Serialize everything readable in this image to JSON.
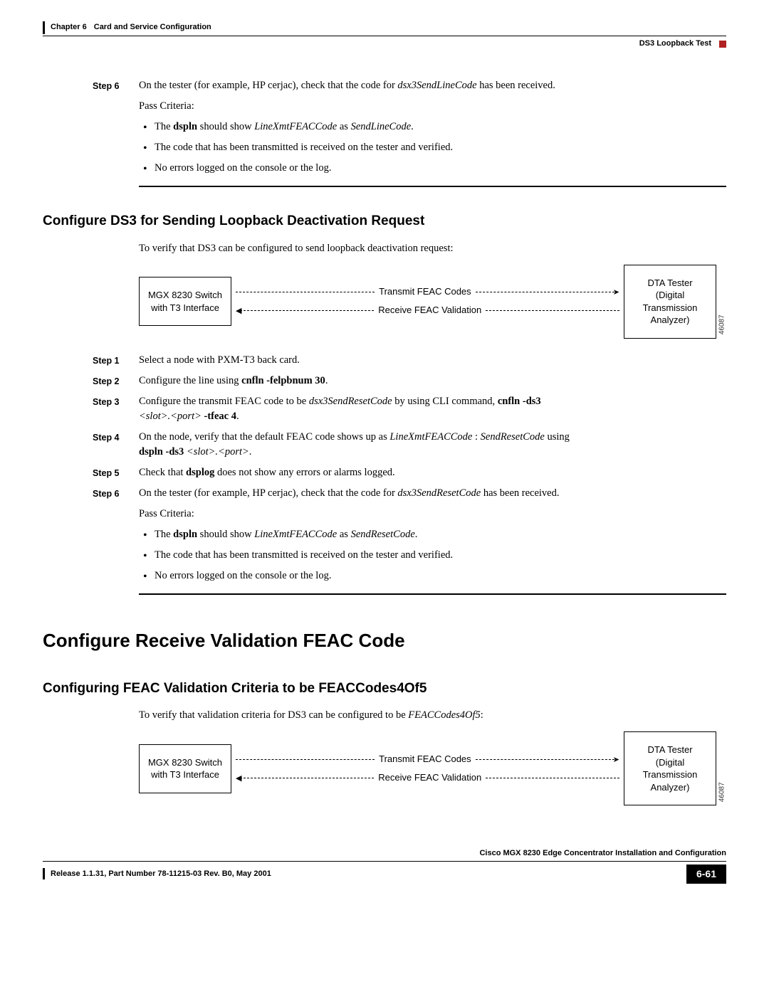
{
  "header": {
    "chapter_label": "Chapter 6",
    "chapter_title": "Card and Service Configuration",
    "subtitle": "DS3 Loopback Test"
  },
  "top_step6": {
    "label": "Step 6",
    "line1_a": "On the tester (for example, HP cerjac), check that the code for ",
    "line1_i": "dsx3SendLineCode",
    "line1_b": " has been received.",
    "line2": "Pass Criteria:",
    "bullet1_a": "The ",
    "bullet1_b": "dspln",
    "bullet1_c": " should show ",
    "bullet1_d": "LineXmtFEACCode",
    "bullet1_e": " as ",
    "bullet1_f": "SendLineCode",
    "bullet1_g": ".",
    "bullet2": "The code that has been transmitted is received on the tester and verified.",
    "bullet3": "No errors logged on the console or the log."
  },
  "section_h2_a": "Configure DS3 for Sending Loopback Deactivation Request",
  "intro_a": "To verify that DS3 can be configured to send loopback deactivation request:",
  "diagram": {
    "left_l1": "MGX 8230 Switch",
    "left_l2": "with T3 Interface",
    "top_label": "Transmit FEAC Codes",
    "bottom_label": "Receive FEAC Validation",
    "right_l1": "DTA Tester",
    "right_l2": "(Digital",
    "right_l3": "Transmission",
    "right_l4": "Analyzer)",
    "figid": "46087"
  },
  "steps_a": {
    "s1": {
      "label": "Step 1",
      "text": "Select a node with PXM-T3 back card."
    },
    "s2": {
      "label": "Step 2",
      "pre": "Configure the line using ",
      "cmd": "cnfln -felpbnum 30",
      "post": "."
    },
    "s3": {
      "label": "Step 3",
      "a": "Configure the transmit FEAC code to be ",
      "b": "dsx3SendResetCode",
      "c": " by using CLI command, ",
      "d": "cnfln -ds3",
      "e": "<slot>.<port>",
      "f": " -tfeac 4",
      "g": "."
    },
    "s4": {
      "label": "Step 4",
      "a": "On the node, verify that the default FEAC code shows up as ",
      "b": "LineXmtFEACCode",
      "c": " : ",
      "d": "SendResetCode",
      "e": " using",
      "f": "dspln -ds3 ",
      "g": "<slot>.<port>",
      "h": "."
    },
    "s5": {
      "label": "Step 5",
      "a": "Check that ",
      "b": "dsplog",
      "c": " does not show any errors or alarms logged."
    },
    "s6": {
      "label": "Step 6",
      "a": "On the tester (for example, HP cerjac), check that the code for ",
      "b": "dsx3SendResetCode",
      "c": " has been received.",
      "pass": "Pass Criteria:",
      "b1a": "The ",
      "b1b": "dspln",
      "b1c": " should show ",
      "b1d": "LineXmtFEACCode",
      "b1e": " as ",
      "b1f": "SendResetCode",
      "b1g": ".",
      "b2": "The code that has been transmitted is received on the tester and verified.",
      "b3": "No errors logged on the console or the log."
    }
  },
  "section_h1": "Configure Receive Validation FEAC Code",
  "section_h2_b": "Configuring FEAC Validation Criteria to be FEACCodes4Of5",
  "intro_b_a": "To verify that validation criteria for DS3 can be configured to be ",
  "intro_b_b": "FEACCodes4Of5",
  "intro_b_c": ":",
  "footer": {
    "doc_title": "Cisco MGX 8230 Edge Concentrator Installation and Configuration",
    "release": "Release 1.1.31, Part Number 78-11215-03 Rev. B0, May 2001",
    "page": "6-61"
  }
}
